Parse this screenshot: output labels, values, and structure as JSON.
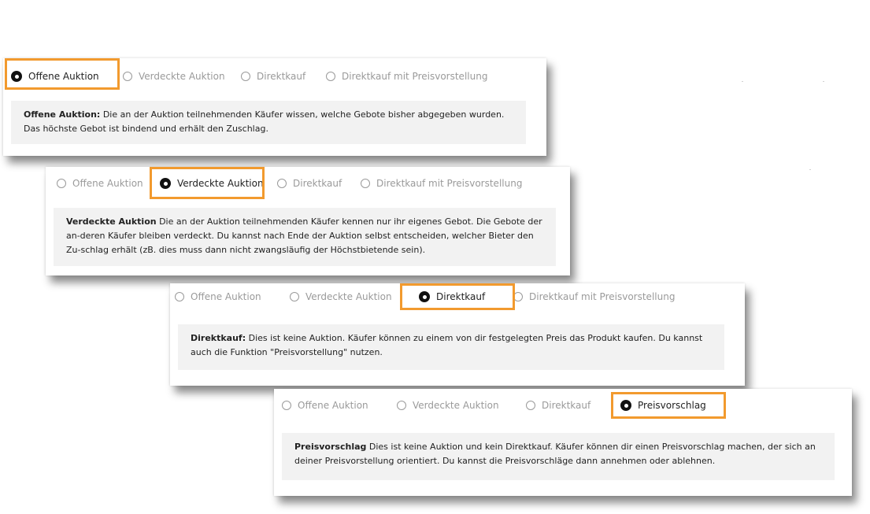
{
  "panels": [
    {
      "options": [
        "Offene Auktion",
        "Verdeckte Auktion",
        "Direktkauf",
        "Direktkauf mit Preisvorstellung"
      ],
      "selected": "Offene Auktion",
      "desc_title": "Offene Auktion:",
      "desc_text": " Die an der Auktion teilnehmenden Käufer wissen, welche Gebote bisher abgegeben wurden. Das höchste Gebot ist bindend und erhält den Zuschlag."
    },
    {
      "options": [
        "Offene Auktion",
        "Verdeckte Auktion",
        "Direktkauf",
        "Direktkauf mit Preisvorstellung"
      ],
      "selected": "Verdeckte Auktion",
      "desc_title": "Verdeckte Auktion",
      "desc_text": " Die an der Auktion teilnehmenden Käufer kennen nur ihr eigenes Gebot. Die Gebote der an-deren Käufer bleiben verdeckt. Du kannst nach Ende der Auktion selbst entscheiden, welcher Bieter den Zu-schlag erhält (zB. dies muss dann nicht zwangsläufig der Höchstbietende sein)."
    },
    {
      "options": [
        "Offene Auktion",
        "Verdeckte Auktion",
        "Direktkauf",
        "Direktkauf mit Preisvorstellung"
      ],
      "selected": "Direktkauf",
      "desc_title": "Direktkauf:",
      "desc_text": " Dies ist keine Auktion. Käufer können zu einem von dir festgelegten Preis das Produkt kaufen. Du kannst auch die Funktion \"Preisvorstellung\" nutzen."
    },
    {
      "options": [
        "Offene Auktion",
        "Verdeckte Auktion",
        "Direktkauf",
        "Preisvorschlag"
      ],
      "selected": "Preisvorschlag",
      "desc_title": "Preisvorschlag",
      "desc_text": " Dies ist keine Auktion und kein Direktkauf. Käufer können dir einen Preisvorschlag machen, der sich an deiner Preisvorstellung orientiert. Du kannst die Preisvorschläge dann annehmen oder ablehnen."
    }
  ],
  "colors": {
    "highlight": "#f29a2e",
    "desc_bg": "#f2f2f2",
    "unselected": "#9a9a9a"
  }
}
